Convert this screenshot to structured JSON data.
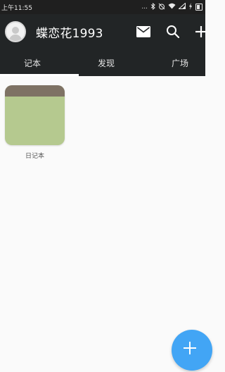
{
  "status_bar": {
    "time": "上午11:55",
    "indicators": "...",
    "icons": [
      "bluetooth-icon",
      "alarm-off-icon",
      "wifi-icon",
      "signal-icon",
      "battery-icon"
    ]
  },
  "header": {
    "username": "蝶恋花1993",
    "avatar_icon": "avatar-icon",
    "mail_icon": "mail-icon",
    "search_icon": "search-icon",
    "add_icon": "plus-icon"
  },
  "tabs": [
    {
      "label": "记本",
      "active": true
    },
    {
      "label": "发现",
      "active": false
    },
    {
      "label": "广场",
      "active": false
    }
  ],
  "notebooks": [
    {
      "label": "日记本",
      "cover_color": "#b5c98f",
      "band_color": "#7e7264"
    }
  ],
  "fab": {
    "icon": "plus-icon",
    "color": "#42a5f5"
  },
  "colors": {
    "app_bar": "#222526",
    "accent": "#42a5f5",
    "background": "#fafafa"
  }
}
